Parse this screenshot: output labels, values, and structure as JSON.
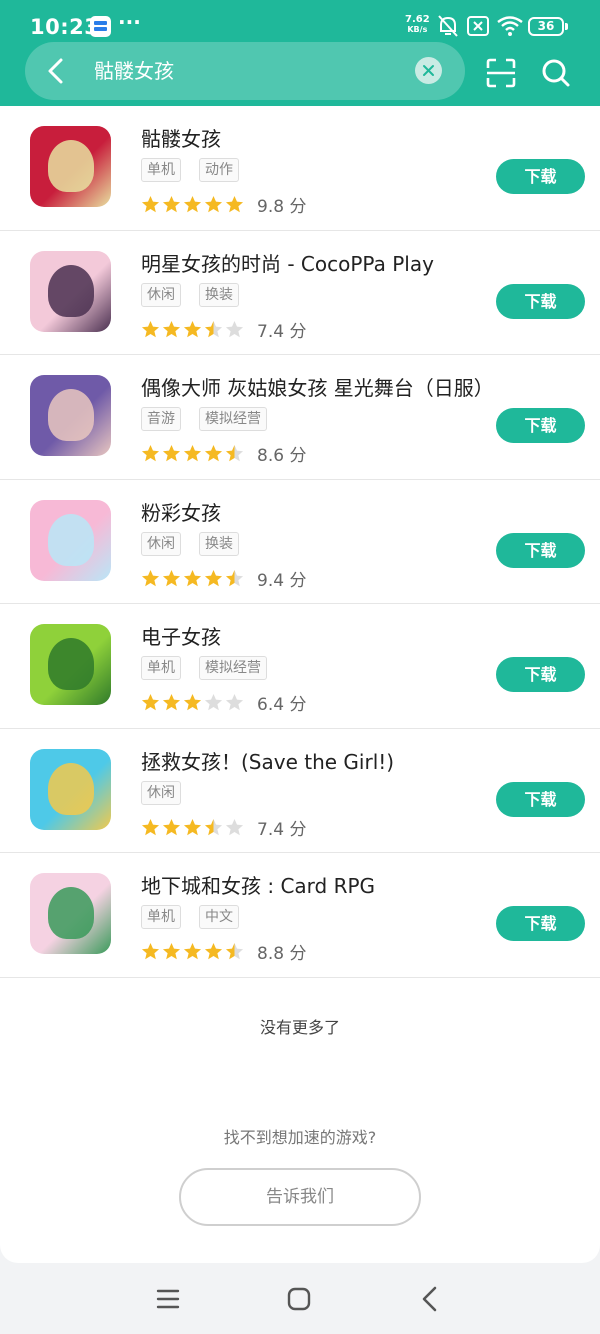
{
  "status": {
    "time": "10:23",
    "net_speed_top": "7.62",
    "net_speed_bottom": "KB/s",
    "battery": "36"
  },
  "search": {
    "query": "骷髅女孩"
  },
  "games": [
    {
      "name": "骷髅女孩",
      "tags": [
        "单机",
        "动作"
      ],
      "stars": 5,
      "score": "9.8 分",
      "button": "下载",
      "icon_colors": [
        "#c81e3c",
        "#e8e0a0"
      ]
    },
    {
      "name": "明星女孩的时尚 - CocoPPa Play",
      "tags": [
        "休闲",
        "换装"
      ],
      "stars": 3.5,
      "score": "7.4 分",
      "button": "下载",
      "icon_colors": [
        "#f3c9d9",
        "#4a3050"
      ]
    },
    {
      "name": "偶像大师 灰姑娘女孩 星光舞台（日服）",
      "tags": [
        "音游",
        "模拟经营"
      ],
      "stars": 4.5,
      "score": "8.6 分",
      "button": "下载",
      "icon_colors": [
        "#6f5aa8",
        "#e9c7c0"
      ]
    },
    {
      "name": "粉彩女孩",
      "tags": [
        "休闲",
        "换装"
      ],
      "stars": 4.5,
      "score": "9.4 分",
      "button": "下载",
      "icon_colors": [
        "#f7b9d6",
        "#b9e6f7"
      ]
    },
    {
      "name": "电子女孩",
      "tags": [
        "单机",
        "模拟经营"
      ],
      "stars": 3,
      "score": "6.4 分",
      "button": "下载",
      "icon_colors": [
        "#8fd13a",
        "#2f7a2a"
      ]
    },
    {
      "name": "拯救女孩！(Save the Girl!)",
      "tags": [
        "休闲"
      ],
      "stars": 3.5,
      "score": "7.4 分",
      "button": "下载",
      "icon_colors": [
        "#4ec9e8",
        "#f2c94c"
      ]
    },
    {
      "name": "地下城和女孩 : Card RPG",
      "tags": [
        "单机",
        "中文"
      ],
      "stars": 4.5,
      "score": "8.8 分",
      "button": "下载",
      "icon_colors": [
        "#f5d2e2",
        "#3a9a5a"
      ]
    }
  ],
  "footer": {
    "no_more": "没有更多了",
    "cant_find": "找不到想加速的游戏?",
    "tell_us": "告诉我们"
  },
  "colors": {
    "accent": "#1fb89a",
    "star": "#f5b922",
    "star_empty": "#dddddd"
  }
}
